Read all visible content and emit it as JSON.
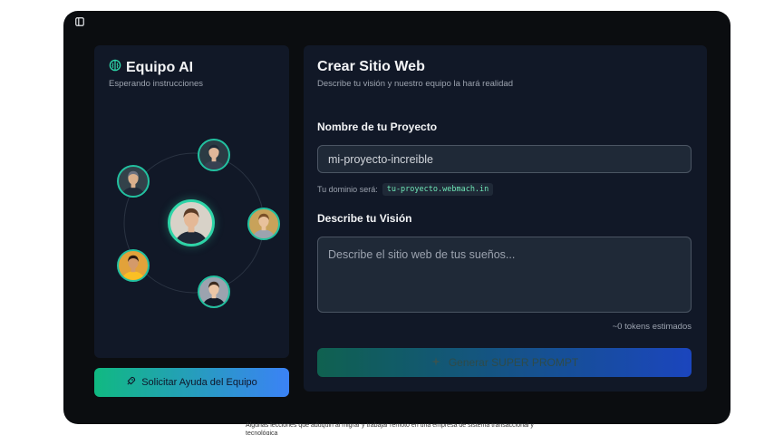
{
  "team": {
    "title": "Equipo AI",
    "subtitle": "Esperando instrucciones",
    "brain_icon": "brain-icon",
    "help_button": "Solicitar Ayuda del Equipo",
    "help_icon": "rocket-icon",
    "members": [
      {
        "name": "top-center",
        "shirt": "#374151",
        "skin": "#e0b89a",
        "hair": "#1f2937",
        "bg": "#2b3b44"
      },
      {
        "name": "left-upper",
        "shirt": "#1f2937",
        "skin": "#d9b08c",
        "hair": "#6b7280",
        "bg": "#33424a"
      },
      {
        "name": "center",
        "shirt": "#1f2937",
        "skin": "#e4b896",
        "hair": "#5a3b26",
        "bg": "#d8d2c8"
      },
      {
        "name": "right",
        "shirt": "#9ca3af",
        "skin": "#e8c19c",
        "hair": "#7a5028",
        "bg": "#c8a25a"
      },
      {
        "name": "left-lower",
        "shirt": "#fbbf24",
        "skin": "#d49a6a",
        "hair": "#2b1a10",
        "bg": "#e2a23a"
      },
      {
        "name": "bottom",
        "shirt": "#111827",
        "skin": "#ebc6a6",
        "hair": "#3b2a1e",
        "bg": "#9ca3af"
      }
    ],
    "colors": {
      "accent": "#2dd4a7",
      "orbit": "#374151"
    }
  },
  "create": {
    "title": "Crear Sitio Web",
    "subtitle": "Describe tu visión y nuestro equipo la hará realidad",
    "project_label": "Nombre de tu Proyecto",
    "project_value": "mi-proyecto-increible",
    "domain_label": "Tu dominio será:",
    "domain_value": "tu-proyecto.webmach.in",
    "vision_label": "Describe tu Visión",
    "vision_placeholder": "Describe el sitio web de tus sueños...",
    "token_count": "~0 tokens estimados",
    "generate_button": "Generar SUPER PROMPT",
    "generate_icon": "sparkle-icon"
  },
  "footer_text": "Algunas lecciones que aduquiri al migrar y trabajar remoto en una empresa de sistema transaccional y tecnológica"
}
